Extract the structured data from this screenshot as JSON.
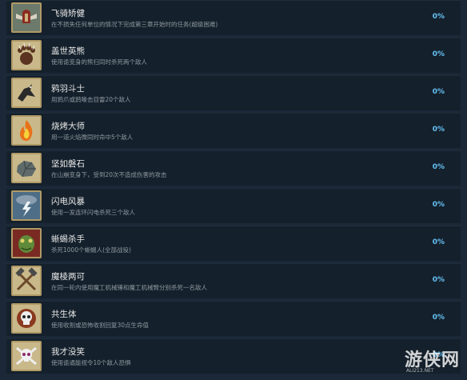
{
  "achievements": [
    {
      "title": "飞骑矫健",
      "desc": "在不损失任何单位的情况下完成第三章开始时的任务(超级困难)",
      "pct": "0%",
      "icon": "winged-helmet-icon"
    },
    {
      "title": "盖世英熊",
      "desc": "使用诡变身的熊扫同时杀死两个敌人",
      "pct": "0%",
      "icon": "bear-paw-icon"
    },
    {
      "title": "鸦羽斗士",
      "desc": "用鸦爪或鸦喙击目雷20个敌人",
      "pct": "0%",
      "icon": "raven-icon"
    },
    {
      "title": "烧烤大师",
      "desc": "用一道火焰微同时命中5个敌人",
      "pct": "0%",
      "icon": "fire-icon"
    },
    {
      "title": "坚如磐石",
      "desc": "在山崩变身下，受到20次不造成伤害的攻击",
      "pct": "0%",
      "icon": "rock-fist-icon"
    },
    {
      "title": "闪电风暴",
      "desc": "使用一发连环闪电杀死三个敌人",
      "pct": "0%",
      "icon": "lightning-cloud-icon"
    },
    {
      "title": "蜥蜴杀手",
      "desc": "杀死1000个蜥蜴人(全部战役)",
      "pct": "0%",
      "icon": "lizard-head-icon"
    },
    {
      "title": "魔棱两可",
      "desc": "在同一轮内使用魔工机械锤和魔工机械臂分别杀死一名敌人",
      "pct": "0%",
      "icon": "crossed-hammers-icon"
    },
    {
      "title": "共生体",
      "desc": "使用收割或恐怖收割回复30点生命值",
      "pct": "0%",
      "icon": "skull-orb-icon"
    },
    {
      "title": "我才没笑",
      "desc": "使用诡谲能视令10个敌人恐惧",
      "pct": "0%",
      "icon": "skull-crossbones-icon"
    }
  ],
  "watermark": {
    "text": "游侠网",
    "sub": "ALI213.NET"
  }
}
